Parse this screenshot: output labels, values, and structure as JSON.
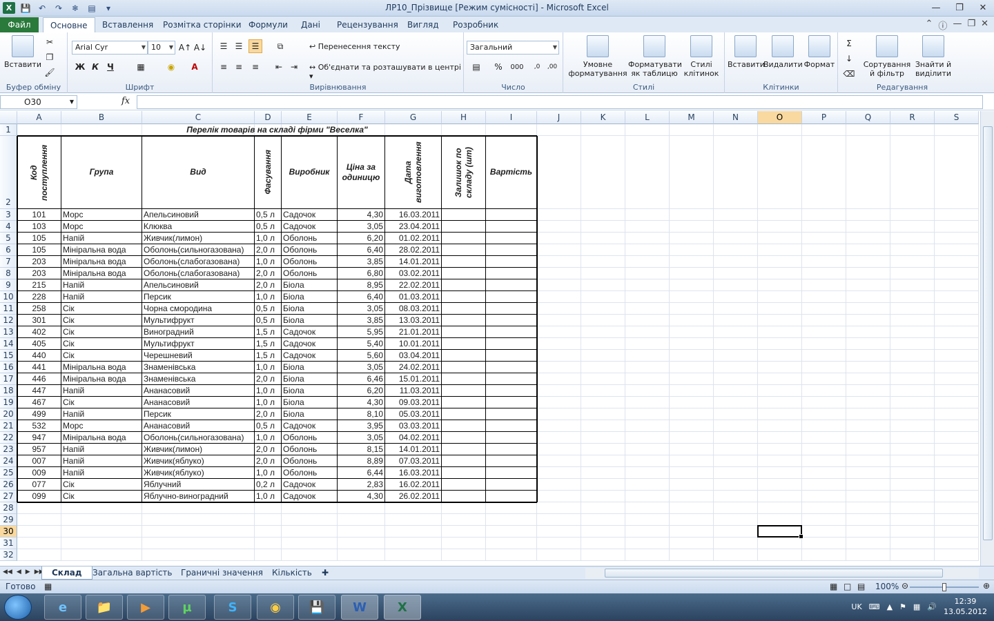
{
  "window": {
    "title": "ЛР10_Прізвище  [Режим сумісності]  -  Microsoft Excel"
  },
  "ribbon_tabs": {
    "file": "Файл",
    "items": [
      "Основне",
      "Вставлення",
      "Розмітка сторінки",
      "Формули",
      "Дані",
      "Рецензування",
      "Вигляд",
      "Розробник"
    ]
  },
  "ribbon": {
    "paste": "Вставити",
    "clipboard_label": "Буфер обміну",
    "font_name": "Arial Cyr",
    "font_size": "10",
    "font_label": "Шрифт",
    "wrap_text": "Перенесення тексту",
    "merge_center": "Об'єднати та розташувати в центрі",
    "align_label": "Вирівнювання",
    "number_format": "Загальний",
    "number_label": "Число",
    "conditional": "Умовне форматування",
    "format_table": "Форматувати як таблицю",
    "cell_styles": "Стилі клітинок",
    "styles_label": "Стилі",
    "insert": "Вставити",
    "delete": "Видалити",
    "format": "Формат",
    "cells_label": "Клітинки",
    "sort_filter": "Сортування й фільтр",
    "find_select": "Знайти й виділити",
    "editing_label": "Редагування",
    "bold": "Ж",
    "italic": "К",
    "underline": "Ч",
    "percent": "%",
    "thousands": "000"
  },
  "formula_bar": {
    "name_box": "O30",
    "fx": "fx",
    "formula": ""
  },
  "sheet": {
    "columns": [
      "A",
      "B",
      "C",
      "D",
      "E",
      "F",
      "G",
      "H",
      "I",
      "J",
      "K",
      "L",
      "M",
      "N",
      "O",
      "P",
      "Q",
      "R",
      "S"
    ],
    "row_numbers": [
      "1",
      "2",
      "3",
      "4",
      "5",
      "6",
      "7",
      "8",
      "9",
      "10",
      "11",
      "12",
      "13",
      "14",
      "15",
      "16",
      "17",
      "18",
      "19",
      "20",
      "21",
      "22",
      "23",
      "24",
      "25",
      "26",
      "27",
      "28",
      "29",
      "30",
      "31",
      "32"
    ],
    "selected_column": "O",
    "selected_row": "30",
    "title": "Перелік товарів на складі фірми \"Веселка\"",
    "headers": [
      "Код поступлення",
      "Група",
      "Вид",
      "Фасування",
      "Виробник",
      "Ціна за одиницю",
      "Дата виготовлення",
      "Залишок по складу (шт)",
      "Вартість"
    ],
    "rows": [
      [
        "101",
        "Морс",
        "Апельсиновий",
        "0,5 л",
        "Садочок",
        "4,30",
        "16.03.2011"
      ],
      [
        "103",
        "Морс",
        "Клюква",
        "0,5 л",
        "Садочок",
        "3,05",
        "23.04.2011"
      ],
      [
        "105",
        "Напій",
        "Живчик(лимон)",
        "1,0 л",
        "Оболонь",
        "6,20",
        "01.02.2011"
      ],
      [
        "105",
        "Мініральна вода",
        "Оболонь(сильногазована)",
        "2,0 л",
        "Оболонь",
        "6,40",
        "28.02.2011"
      ],
      [
        "203",
        "Мініральна вода",
        "Оболонь(слабогазована)",
        "1,0 л",
        "Оболонь",
        "3,85",
        "14.01.2011"
      ],
      [
        "203",
        "Мініральна вода",
        "Оболонь(слабогазована)",
        "2,0 л",
        "Оболонь",
        "6,80",
        "03.02.2011"
      ],
      [
        "215",
        "Напій",
        "Апельсиновий",
        "2,0 л",
        "Біола",
        "8,95",
        "22.02.2011"
      ],
      [
        "228",
        "Напій",
        "Персик",
        "1,0 л",
        "Біола",
        "6,40",
        "01.03.2011"
      ],
      [
        "258",
        "Сік",
        "Чорна смородина",
        "0,5 л",
        "Біола",
        "3,05",
        "08.03.2011"
      ],
      [
        "301",
        "Сік",
        "Мультифрукт",
        "0,5 л",
        "Біола",
        "3,85",
        "13.03.2011"
      ],
      [
        "402",
        "Сік",
        "Виноградний",
        "1,5 л",
        "Садочок",
        "5,95",
        "21.01.2011"
      ],
      [
        "405",
        "Сік",
        "Мультифрукт",
        "1,5 л",
        "Садочок",
        "5,40",
        "10.01.2011"
      ],
      [
        "440",
        "Сік",
        "Черешневий",
        "1,5 л",
        "Садочок",
        "5,60",
        "03.04.2011"
      ],
      [
        "441",
        "Мініральна вода",
        "Знаменівська",
        "1,0 л",
        "Біола",
        "3,05",
        "24.02.2011"
      ],
      [
        "446",
        "Мініральна вода",
        "Знаменівська",
        "2,0 л",
        "Біола",
        "6,46",
        "15.01.2011"
      ],
      [
        "447",
        "Напій",
        "Ананасовий",
        "1,0 л",
        "Біола",
        "6,20",
        "11.03.2011"
      ],
      [
        "467",
        "Сік",
        "Ананасовий",
        "1,0 л",
        "Біола",
        "4,30",
        "09.03.2011"
      ],
      [
        "499",
        "Напій",
        "Персик",
        "2,0 л",
        "Біола",
        "8,10",
        "05.03.2011"
      ],
      [
        "532",
        "Морс",
        "Ананасовий",
        "0,5 л",
        "Садочок",
        "3,95",
        "03.03.2011"
      ],
      [
        "947",
        "Мініральна вода",
        "Оболонь(сильногазована)",
        "1,0 л",
        "Оболонь",
        "3,05",
        "04.02.2011"
      ],
      [
        "957",
        "Напій",
        "Живчик(лимон)",
        "2,0 л",
        "Оболонь",
        "8,15",
        "14.01.2011"
      ],
      [
        "007",
        "Напій",
        "Живчик(яблуко)",
        "2,0 л",
        "Оболонь",
        "8,89",
        "07.03.2011"
      ],
      [
        "009",
        "Напій",
        "Живчик(яблуко)",
        "1,0 л",
        "Оболонь",
        "6,44",
        "16.03.2011"
      ],
      [
        "077",
        "Сік",
        "Яблучний",
        "0,2 л",
        "Садочок",
        "2,83",
        "16.02.2011"
      ],
      [
        "099",
        "Сік",
        "Яблучно-виноградний",
        "1,0 л",
        "Садочок",
        "4,30",
        "26.02.2011"
      ]
    ]
  },
  "sheet_tabs": [
    "Склад",
    "Загальна вартість",
    "Граничні значення",
    "Кількість"
  ],
  "active_sheet": "Склад",
  "status": {
    "ready": "Готово",
    "zoom": "100%"
  },
  "taskbar": {
    "lang": "UK",
    "time": "12:39",
    "date": "13.05.2012",
    "apps": [
      "internet-explorer",
      "file-explorer",
      "media-player",
      "utorrent",
      "skype",
      "chrome",
      "save-disk",
      "word",
      "excel"
    ]
  }
}
